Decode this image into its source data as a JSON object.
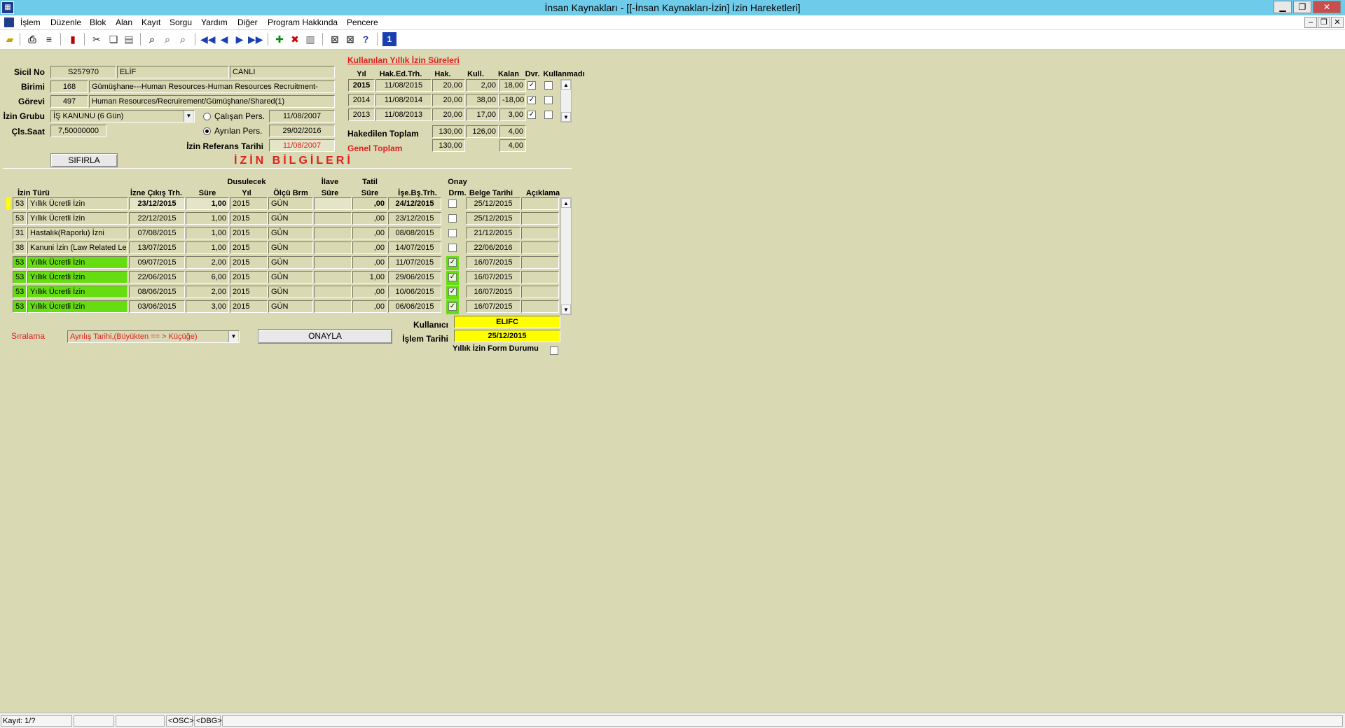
{
  "window": {
    "title": "İnsan Kaynakları - [[-İnsan Kaynakları-İzin] İzin Hareketleri]"
  },
  "menu": [
    "İşlem",
    "Düzenle",
    "Blok",
    "Alan",
    "Kayıt",
    "Sorgu",
    "Yardım",
    "Diğer",
    "Program Hakkında",
    "Pencere"
  ],
  "toolbar_icons": [
    "open-icon",
    "print-icon",
    "print-setup-icon",
    "exit-icon",
    "cut-icon",
    "copy-icon",
    "paste-icon",
    "query-icon",
    "query-exec-icon",
    "query-cancel-icon",
    "first-record-icon",
    "prev-record-icon",
    "next-record-icon",
    "last-record-icon",
    "insert-record-icon",
    "delete-record-icon",
    "clear-record-icon",
    "tool-a-icon",
    "tool-b-icon",
    "help-icon",
    "info-icon"
  ],
  "employee": {
    "sicil_label": "Sicil No",
    "sicil_no": "S257970",
    "ad": "ELİF",
    "soyad": "CANLI",
    "birimi_label": "Birimi",
    "birim_kod": "168",
    "birim_ad": "Gümüşhane---Human Resources-Human Resources Recruitment-",
    "gorevi_label": "Görevi",
    "gorev_kod": "497",
    "gorev_ad": "Human Resources/Recruirement/Gümüşhane/Shared(1)",
    "izin_grubu_label": "İzin Grubu",
    "izin_grubu": "İŞ KANUNU (6 Gün)",
    "calisan_label": "Çalışan Pers.",
    "calisan_tarih": "11/08/2007",
    "ayrilan_label": "Ayrılan Pers.",
    "ayrilan_tarih": "29/02/2016",
    "cls_saat_label": "Çls.Saat",
    "cls_saat": "7,50000000",
    "referans_label": "İzin Referans Tarihi",
    "referans_tarih": "11/08/2007",
    "sifirla_label": "SIFIRLA"
  },
  "yillik": {
    "title": "Kullanılan Yıllık İzin Süreleri",
    "headers": [
      "Yıl",
      "Hak.Ed.Trh.",
      "Hak.",
      "Kull.",
      "Kalan",
      "Dvr.",
      "Kullanmadı"
    ],
    "rows": [
      {
        "yil": "2015",
        "hak_ed": "11/08/2015",
        "hak": "20,00",
        "kull": "2,00",
        "kalan": "18,00",
        "dvr": true,
        "kullanmadi": false
      },
      {
        "yil": "2014",
        "hak_ed": "11/08/2014",
        "hak": "20,00",
        "kull": "38,00",
        "kalan": "-18,00",
        "dvr": true,
        "kullanmadi": false
      },
      {
        "yil": "2013",
        "hak_ed": "11/08/2013",
        "hak": "20,00",
        "kull": "17,00",
        "kalan": "3,00",
        "dvr": true,
        "kullanmadi": false
      }
    ],
    "hakedilen_label": "Hakedilen Toplam",
    "hakedilen_hak": "130,00",
    "hakedilen_kull": "126,00",
    "hakedilen_kalan": "4,00",
    "genel_label": "Genel Toplam",
    "genel_hak": "130,00",
    "genel_kalan": "4,00"
  },
  "izin_bilgileri_title": "İZİN BİLGİLERİ",
  "grid": {
    "headers": {
      "izin_turu": "İzin Türü",
      "cikis": "İzne Çıkış Trh.",
      "sure": "Süre",
      "dusulecek_1": "Dusulecek",
      "dusulecek_2": "Yıl",
      "olcu": "Ölçü Brm",
      "ilave_1": "İlave",
      "ilave_2": "Süre",
      "tatil_1": "Tatil",
      "tatil_2": "Süre",
      "ise_bs": "İşe.Bş.Trh.",
      "onay_1": "Onay",
      "onay_2": "Drm.",
      "belge": "Belge Tarihi",
      "aciklama": "Açıklama"
    },
    "rows": [
      {
        "kod": "53",
        "tur": "Yıllık Ücretli İzin",
        "cikis": "23/12/2015",
        "sure": "1,00",
        "yil": "2015",
        "olcu": "GÜN",
        "ilave": "",
        "tatil": ",00",
        "ise_bs": "24/12/2015",
        "onay": false,
        "belge": "25/12/2015",
        "aciklama": "",
        "green": false
      },
      {
        "kod": "53",
        "tur": "Yıllık Ücretli İzin",
        "cikis": "22/12/2015",
        "sure": "1,00",
        "yil": "2015",
        "olcu": "GÜN",
        "ilave": "",
        "tatil": ",00",
        "ise_bs": "23/12/2015",
        "onay": false,
        "belge": "25/12/2015",
        "aciklama": "",
        "green": false
      },
      {
        "kod": "31",
        "tur": "Hastalık(Raporlu) İzni",
        "cikis": "07/08/2015",
        "sure": "1,00",
        "yil": "2015",
        "olcu": "GÜN",
        "ilave": "",
        "tatil": ",00",
        "ise_bs": "08/08/2015",
        "onay": false,
        "belge": "21/12/2015",
        "aciklama": "",
        "green": false
      },
      {
        "kod": "38",
        "tur": "Kanuni İzin (Law Related Le",
        "cikis": "13/07/2015",
        "sure": "1,00",
        "yil": "2015",
        "olcu": "GÜN",
        "ilave": "",
        "tatil": ",00",
        "ise_bs": "14/07/2015",
        "onay": false,
        "belge": "22/06/2016",
        "aciklama": "",
        "green": false
      },
      {
        "kod": "53",
        "tur": "Yıllık Ücretli İzin",
        "cikis": "09/07/2015",
        "sure": "2,00",
        "yil": "2015",
        "olcu": "GÜN",
        "ilave": "",
        "tatil": ",00",
        "ise_bs": "11/07/2015",
        "onay": true,
        "belge": "16/07/2015",
        "aciklama": "",
        "green": true
      },
      {
        "kod": "53",
        "tur": "Yıllık Ücretli İzin",
        "cikis": "22/06/2015",
        "sure": "6,00",
        "yil": "2015",
        "olcu": "GÜN",
        "ilave": "",
        "tatil": "1,00",
        "ise_bs": "29/06/2015",
        "onay": true,
        "belge": "16/07/2015",
        "aciklama": "",
        "green": true
      },
      {
        "kod": "53",
        "tur": "Yıllık Ücretli İzin",
        "cikis": "08/06/2015",
        "sure": "2,00",
        "yil": "2015",
        "olcu": "GÜN",
        "ilave": "",
        "tatil": ",00",
        "ise_bs": "10/06/2015",
        "onay": true,
        "belge": "16/07/2015",
        "aciklama": "",
        "green": true
      },
      {
        "kod": "53",
        "tur": "Yıllık Ücretli İzin",
        "cikis": "03/06/2015",
        "sure": "3,00",
        "yil": "2015",
        "olcu": "GÜN",
        "ilave": "",
        "tatil": ",00",
        "ise_bs": "06/06/2015",
        "onay": true,
        "belge": "16/07/2015",
        "aciklama": "",
        "green": true
      }
    ]
  },
  "bottom": {
    "siralama_label": "Sıralama",
    "siralama": "Ayrılış Tarihi,(Büyükten == > Küçüğe)",
    "onayla_label": "ONAYLA",
    "kullanici_label": "Kullanıcı",
    "kullanici": "ELIFC",
    "islem_label": "İşlem Tarihi",
    "islem_tarihi": "25/12/2015",
    "form_durumu_label": "Yıllık İzin Form Durumu"
  },
  "status": {
    "kayit": "Kayıt: 1/?",
    "osc": "<OSC>",
    "dbg": "<DBG>"
  },
  "colors": {
    "background": "#d9d9b3",
    "titlebar": "#6ecbe9",
    "approved_row": "#66dd11",
    "highlight": "#ffff00",
    "accent_red": "#e02020"
  }
}
